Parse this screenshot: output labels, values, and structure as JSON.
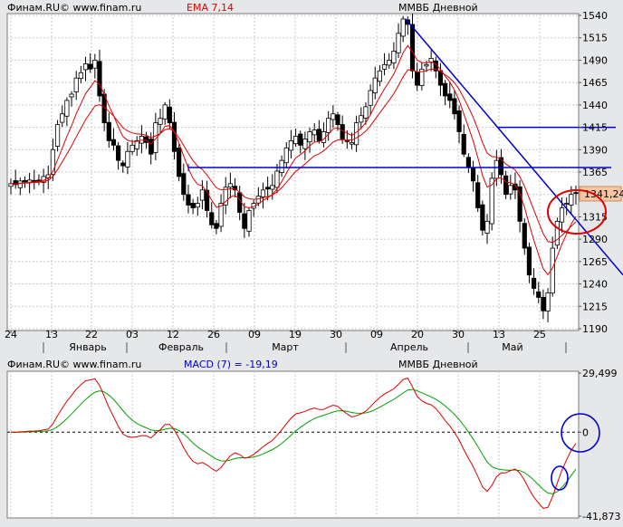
{
  "top_panel": {
    "source": "Финам.RU© www.finam.ru",
    "indicator": "EMA 7,14",
    "instrument": "ММВБ Дневной",
    "current_price_label": "1341,24"
  },
  "bottom_panel": {
    "source": "Финам.RU© www.finam.ru",
    "indicator": "MACD (7) = -19,19",
    "instrument": "ММВБ Дневной"
  },
  "x_axis": {
    "day_ticks": [
      "24",
      "13",
      "22",
      "03",
      "12",
      "26",
      "09",
      "19",
      "30",
      "09",
      "20",
      "30",
      "13",
      "25"
    ],
    "month_labels": [
      "Январь",
      "Февраль",
      "Март",
      "Апрель",
      "Май"
    ]
  },
  "chart_data": [
    {
      "type": "candlestick",
      "title": "ММВБ Дневной",
      "ylim": [
        1190,
        1540
      ],
      "yticks": [
        "1540",
        "1515",
        "1490",
        "1465",
        "1440",
        "1415",
        "1390",
        "1365",
        "1340",
        "1315",
        "1290",
        "1265",
        "1240",
        "1215",
        "1190"
      ],
      "series": [
        {
          "name": "EMA 7",
          "color": "#e00000"
        },
        {
          "name": "EMA 14",
          "color": "#e00000"
        }
      ],
      "candles_close": [
        1352,
        1351,
        1355,
        1354,
        1356,
        1355,
        1356,
        1360,
        1362,
        1390,
        1418,
        1430,
        1445,
        1452,
        1470,
        1476,
        1486,
        1480,
        1490,
        1450,
        1420,
        1400,
        1395,
        1378,
        1372,
        1388,
        1395,
        1400,
        1405,
        1398,
        1385,
        1420,
        1425,
        1440,
        1420,
        1388,
        1360,
        1340,
        1328,
        1325,
        1330,
        1345,
        1322,
        1306,
        1302,
        1330,
        1348,
        1352,
        1345,
        1320,
        1302,
        1322,
        1330,
        1338,
        1345,
        1346,
        1350,
        1366,
        1378,
        1392,
        1400,
        1405,
        1395,
        1402,
        1410,
        1412,
        1400,
        1410,
        1425,
        1430,
        1418,
        1402,
        1400,
        1398,
        1420,
        1428,
        1438,
        1456,
        1470,
        1478,
        1485,
        1490,
        1500,
        1520,
        1536,
        1530,
        1478,
        1462,
        1480,
        1485,
        1492,
        1478,
        1462,
        1450,
        1445,
        1430,
        1410,
        1385,
        1370,
        1355,
        1325,
        1300,
        1310,
        1358,
        1378,
        1362,
        1340,
        1350,
        1345,
        1310,
        1280,
        1250,
        1235,
        1225,
        1210,
        1230,
        1280,
        1310,
        1325,
        1330,
        1340,
        1341
      ],
      "trendlines": [
        {
          "kind": "descending",
          "from": [
            1536,
            "Апрель"
          ],
          "to": [
            1250,
            "end"
          ]
        },
        {
          "kind": "horizontal",
          "value": 1370
        },
        {
          "kind": "horizontal",
          "value": 1415
        }
      ],
      "annotations": [
        "red ellipse around last price 1341,24"
      ]
    },
    {
      "type": "line",
      "title": "MACD (7) = -19,19",
      "ylim": [
        -41.873,
        29.499
      ],
      "yticks": [
        "29,499",
        "0",
        "-41,873"
      ],
      "zero_line": 0,
      "series": [
        {
          "name": "MACD (7)",
          "color": "#e00000"
        },
        {
          "name": "Signal",
          "color": "#00a000"
        }
      ],
      "annotations": [
        "blue circle at crossover near 0",
        "blue circle near signal crossing"
      ]
    }
  ]
}
